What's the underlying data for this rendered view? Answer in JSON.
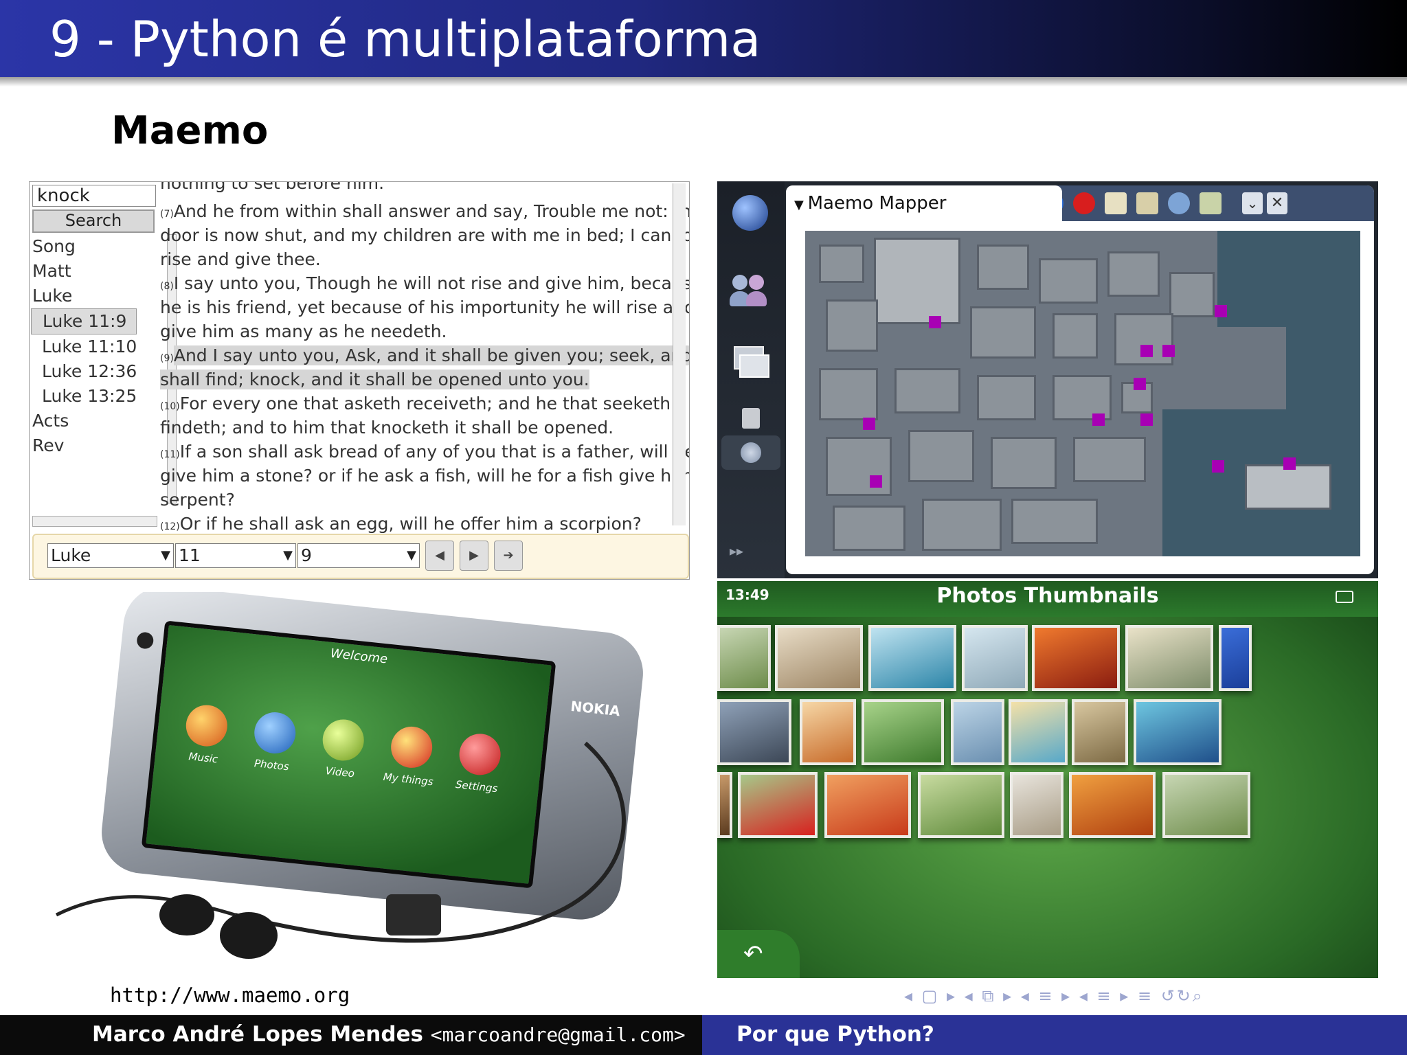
{
  "slide": {
    "title": "9 - Python é multiplataforma",
    "subtitle": "Maemo",
    "url": "http://www.maemo.org"
  },
  "bible_app": {
    "search_value": "knock",
    "search_button": "Search",
    "books": [
      {
        "label": "Song",
        "indent": false,
        "selected": false
      },
      {
        "label": "Matt",
        "indent": false,
        "selected": false
      },
      {
        "label": "Luke",
        "indent": false,
        "selected": false
      },
      {
        "label": "Luke 11:9",
        "indent": false,
        "selected": true
      },
      {
        "label": "Luke 11:10",
        "indent": true,
        "selected": false
      },
      {
        "label": "Luke 12:36",
        "indent": true,
        "selected": false
      },
      {
        "label": "Luke 13:25",
        "indent": true,
        "selected": false
      },
      {
        "label": "Acts",
        "indent": false,
        "selected": false
      },
      {
        "label": "Rev",
        "indent": false,
        "selected": false
      }
    ],
    "verse_lines": [
      {
        "num": "",
        "text": "nothing to set before him.",
        "highlight": false
      },
      {
        "num": "(7)",
        "text": "And he from within shall answer and say, Trouble me not: the",
        "highlight": false
      },
      {
        "num": "",
        "text": "door is now shut, and my children are with me in bed; I cannot",
        "highlight": false
      },
      {
        "num": "",
        "text": "rise and give thee.",
        "highlight": false
      },
      {
        "num": "(8)",
        "text": "I say unto you, Though he will not rise and give him, because",
        "highlight": false
      },
      {
        "num": "",
        "text": "he is his friend, yet because of his importunity he will rise and",
        "highlight": false
      },
      {
        "num": "",
        "text": "give him as many as he needeth.",
        "highlight": false
      },
      {
        "num": "(9)",
        "text": "And I say unto you, Ask, and it shall be given you; seek, and ye",
        "highlight": true
      },
      {
        "num": "",
        "text": "shall find; knock, and it shall be opened unto you.",
        "highlight": true
      },
      {
        "num": "(10)",
        "text": "For every one that asketh receiveth; and he that seeketh",
        "highlight": false
      },
      {
        "num": "",
        "text": "findeth; and to him that knocketh it shall be opened.",
        "highlight": false
      },
      {
        "num": "(11)",
        "text": "If a son shall ask bread of any of you that is a father, will he",
        "highlight": false
      },
      {
        "num": "",
        "text": "give him a stone? or if he ask a fish, will he for a fish give him a",
        "highlight": false
      },
      {
        "num": "",
        "text": "serpent?",
        "highlight": false
      },
      {
        "num": "(12)",
        "text": "Or if he shall ask an egg, will he offer him a scorpion?",
        "highlight": false
      }
    ],
    "book_select": "Luke",
    "chapter_select": "11",
    "verse_select": "9"
  },
  "mapper": {
    "window_title": "Maemo Mapper",
    "sidebar_icons": [
      "globe-icon",
      "contacts-icon",
      "windows-icon",
      "storage-icon",
      "web-icon",
      "fast-forward-icon"
    ],
    "toolbar_icons": [
      "menu-triangle-icon",
      "bluetooth-icon",
      "stop-icon",
      "poi-icon",
      "route-icon",
      "gps-icon",
      "battery-icon"
    ],
    "poi_color": "#a800b4"
  },
  "device": {
    "screen_title": "Welcome",
    "brand": "NOKIA",
    "apps": [
      "Music",
      "Photos",
      "Video",
      "My things",
      "Settings"
    ]
  },
  "photos": {
    "time": "13:49",
    "title": "Photos Thumbnails",
    "back_icon": "back-arrow-icon",
    "rows": 3
  },
  "footer": {
    "author": "Marco André Lopes Mendes",
    "email": "<marcoandre@gmail.com>",
    "title": "Por que Python?",
    "nav_glyphs": "◂ ▢ ▸ ◂ ⧉ ▸ ◂ ≡ ▸ ◂ ≡ ▸  ≡  ↺↻⌕"
  }
}
